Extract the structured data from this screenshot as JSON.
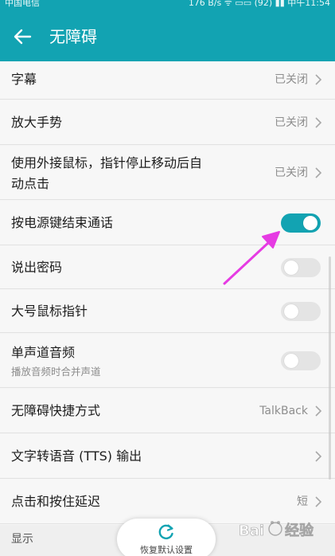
{
  "status_bar": {
    "carrier": "中国电信",
    "right": "176 B/s  ᯤ  ▭▭  (92)  ▮▮  中午11:54"
  },
  "header": {
    "title": "无障碍",
    "back_icon": "back-arrow-icon"
  },
  "settings": [
    {
      "label": "字幕",
      "value": "已关闭",
      "type": "nav"
    },
    {
      "label": "放大手势",
      "value": "已关闭",
      "type": "nav"
    },
    {
      "label_line1": "使用外接鼠标，指针停止移动后自",
      "label_line2": "动点击",
      "value": "已关闭",
      "type": "nav"
    },
    {
      "label": "按电源键结束通话",
      "type": "toggle",
      "checked": true
    },
    {
      "label": "说出密码",
      "type": "toggle",
      "checked": false
    },
    {
      "label": "大号鼠标指针",
      "type": "toggle",
      "checked": false
    },
    {
      "label": "单声道音频",
      "subtitle": "播放音频时合并声道",
      "type": "toggle",
      "checked": false
    },
    {
      "label": "无障碍快捷方式",
      "value": "TalkBack",
      "type": "nav"
    },
    {
      "label": "文字转语音 (TTS) 输出",
      "type": "nav"
    },
    {
      "label": "点击和按住延迟",
      "value": "短",
      "type": "nav"
    }
  ],
  "section": {
    "label": "显示"
  },
  "reset_button": {
    "label": "恢复默认设置",
    "icon": "refresh-icon"
  },
  "colors": {
    "accent": "#12a3b2",
    "annotation_arrow": "#e63be3"
  },
  "annotation": {
    "type": "arrow",
    "points_to": "按电源键结束通话 toggle"
  },
  "watermark": {
    "brand": "Baidu",
    "cn": "经验"
  }
}
